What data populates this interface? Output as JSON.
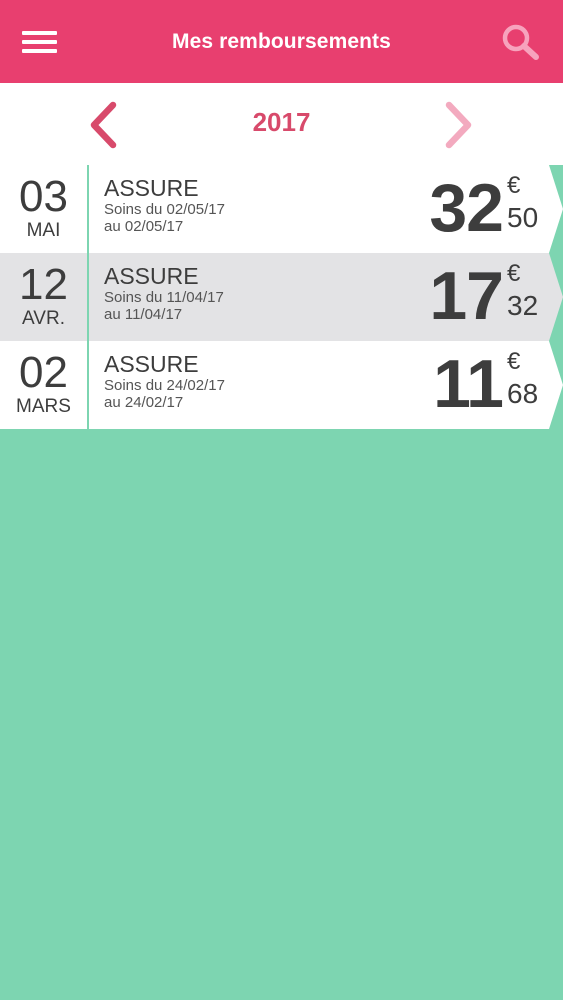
{
  "header": {
    "title": "Mes remboursements",
    "menu_icon": "hamburger-menu-icon",
    "search_icon": "search-icon",
    "background": "#e83f6f"
  },
  "year_nav": {
    "year": "2017",
    "prev_icon": "chevron-left-icon",
    "next_icon": "chevron-right-icon",
    "color": "#d84a6b"
  },
  "reimbursements": [
    {
      "day": "03",
      "month": "MAI",
      "who": "ASSURE",
      "soins_line1": "Soins du 02/05/17",
      "soins_line2": "au 02/05/17",
      "euros": "32",
      "currency": "€",
      "cents": "50",
      "selected": false
    },
    {
      "day": "12",
      "month": "AVR.",
      "who": "ASSURE",
      "soins_line1": "Soins du 11/04/17",
      "soins_line2": "au 11/04/17",
      "euros": "17",
      "currency": "€",
      "cents": "32",
      "selected": true
    },
    {
      "day": "02",
      "month": "MARS",
      "who": "ASSURE",
      "soins_line1": "Soins du 24/02/17",
      "soins_line2": "au 24/02/17",
      "euros": "11",
      "currency": "€",
      "cents": "68",
      "selected": false
    }
  ],
  "colors": {
    "background": "#7dd5b1",
    "row": "#ffffff",
    "row_selected": "#e3e3e5",
    "text": "#3d3d3d"
  }
}
